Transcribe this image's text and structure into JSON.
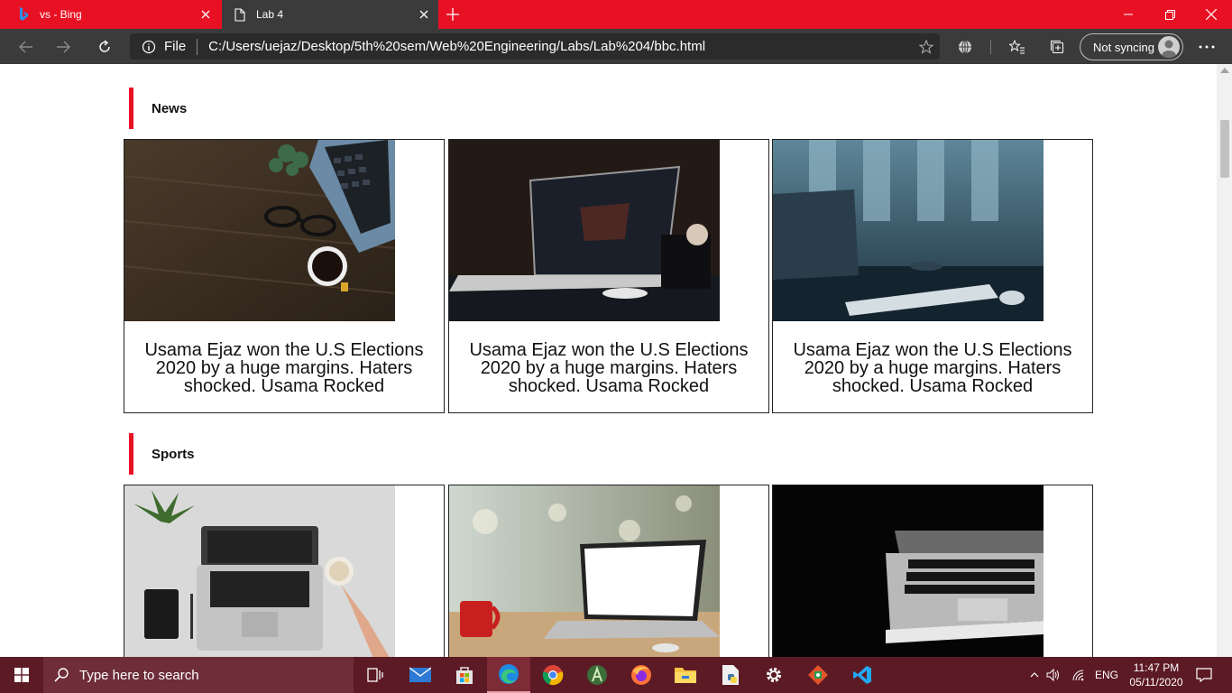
{
  "browser": {
    "tabs": [
      {
        "title": "vs - Bing",
        "active": false
      },
      {
        "title": "Lab 4",
        "active": true
      }
    ],
    "address": {
      "scheme_label": "File",
      "url": "C:/Users/uejaz/Desktop/5th%20sem/Web%20Engineering/Labs/Lab%204/bbc.html"
    },
    "sync_label": "Not syncing"
  },
  "page": {
    "sections": [
      {
        "title": "News",
        "cards": [
          {
            "caption": "Usama Ejaz won the U.S Elections 2020 by a huge margins. Haters shocked. Usama Rocked",
            "image": "desk-laptop-coffee-glasses"
          },
          {
            "caption": "Usama Ejaz won the U.S Elections 2020 by a huge margins. Haters shocked. Usama Rocked",
            "image": "laptop-dark-desk"
          },
          {
            "caption": "Usama Ejaz won the U.S Elections 2020 by a huge margins. Haters shocked. Usama Rocked",
            "image": "keyboard-window-blue"
          }
        ]
      },
      {
        "title": "Sports",
        "cards": [
          {
            "caption": "",
            "image": "laptop-topdown-notebook-coffee"
          },
          {
            "caption": "",
            "image": "laptop-blank-screen-red-mug"
          },
          {
            "caption": "",
            "image": "laptop-black-background"
          }
        ]
      }
    ]
  },
  "taskbar": {
    "search_placeholder": "Type here to search",
    "language": "ENG",
    "time": "11:47 PM",
    "date": "05/11/2020"
  },
  "colors": {
    "accent": "#e81123",
    "toolbar": "#3b3b3b",
    "taskbar": "#5c1a24"
  }
}
